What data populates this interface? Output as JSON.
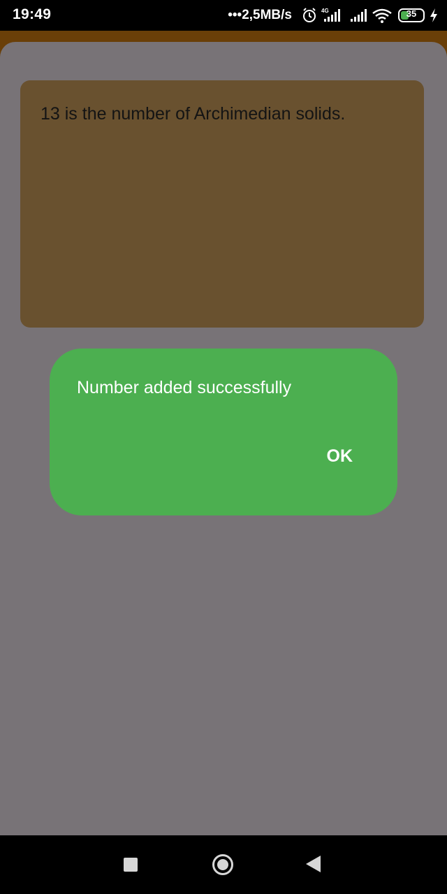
{
  "status_bar": {
    "time": "19:49",
    "net_speed": "•••2,5MB/s",
    "alarm_icon": "alarm-clock-icon",
    "signal_icon": "cell-signal-4g-icon",
    "signal2_icon": "cell-signal-icon",
    "wifi_icon": "wifi-icon",
    "battery_level": "35",
    "battery_fraction": 0.35,
    "charging_icon": "charging-bolt-icon"
  },
  "colors": {
    "app_bar": "#6a3f08",
    "sheet": "#787377",
    "fact_card": "#69512f",
    "dialog": "#4caf50",
    "battery": "#4caf50"
  },
  "fact_card": {
    "text": "13 is the number of Archimedian solids."
  },
  "dialog": {
    "message": "Number added successfully",
    "ok_label": "OK"
  },
  "nav_bar": {
    "recents_icon": "square-recents-icon",
    "home_icon": "circle-home-icon",
    "back_icon": "triangle-back-icon"
  }
}
